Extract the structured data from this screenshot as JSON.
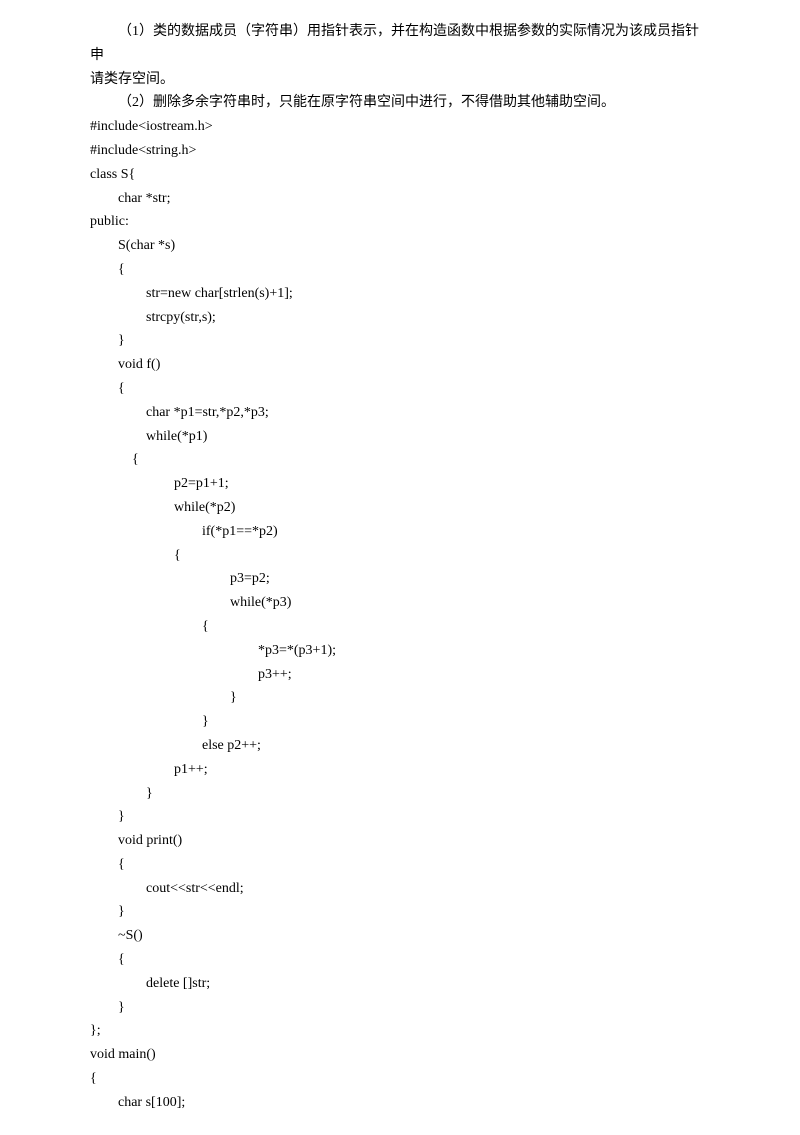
{
  "lines": [
    {
      "cls": "para indent",
      "text": "（1）类的数据成员（字符串）用指针表示，并在构造函数中根据参数的实际情况为该成员指针申"
    },
    {
      "cls": "para",
      "text": "请类存空间。"
    },
    {
      "cls": "para indent",
      "text": "（2）删除多余字符串时，只能在原字符串空间中进行，不得借助其他辅助空间。"
    },
    {
      "cls": "code-line",
      "text": "#include<iostream.h>"
    },
    {
      "cls": "code-line",
      "text": "#include<string.h>"
    },
    {
      "cls": "code-line",
      "text": "class S{"
    },
    {
      "cls": "code-line",
      "text": "        char *str;"
    },
    {
      "cls": "code-line",
      "text": "public:"
    },
    {
      "cls": "code-line",
      "text": "        S(char *s)"
    },
    {
      "cls": "code-line",
      "text": "        {"
    },
    {
      "cls": "code-line",
      "text": "                str=new char[strlen(s)+1];"
    },
    {
      "cls": "code-line",
      "text": "                strcpy(str,s);"
    },
    {
      "cls": "code-line",
      "text": "        }"
    },
    {
      "cls": "code-line",
      "text": "        void f()"
    },
    {
      "cls": "code-line",
      "text": "        {"
    },
    {
      "cls": "code-line",
      "text": "                char *p1=str,*p2,*p3;"
    },
    {
      "cls": "code-line",
      "text": "                while(*p1)"
    },
    {
      "cls": "code-line",
      "text": "            {"
    },
    {
      "cls": "code-line",
      "text": "                        p2=p1+1;"
    },
    {
      "cls": "code-line",
      "text": "                        while(*p2)"
    },
    {
      "cls": "code-line",
      "text": "                                if(*p1==*p2)"
    },
    {
      "cls": "code-line",
      "text": "                        {"
    },
    {
      "cls": "code-line",
      "text": "                                        p3=p2;"
    },
    {
      "cls": "code-line",
      "text": "                                        while(*p3)"
    },
    {
      "cls": "code-line",
      "text": "                                {"
    },
    {
      "cls": "code-line",
      "text": "                                                *p3=*(p3+1);"
    },
    {
      "cls": "code-line",
      "text": "                                                p3++;"
    },
    {
      "cls": "code-line",
      "text": "                                        }"
    },
    {
      "cls": "code-line",
      "text": "                                }"
    },
    {
      "cls": "code-line",
      "text": "                                else p2++;"
    },
    {
      "cls": "code-line",
      "text": "                        p1++;"
    },
    {
      "cls": "code-line",
      "text": "                }"
    },
    {
      "cls": "code-line",
      "text": "        }"
    },
    {
      "cls": "code-line",
      "text": "        void print()"
    },
    {
      "cls": "code-line",
      "text": "        {"
    },
    {
      "cls": "code-line",
      "text": "                cout<<str<<endl;"
    },
    {
      "cls": "code-line",
      "text": "        }"
    },
    {
      "cls": "code-line",
      "text": "        ~S()"
    },
    {
      "cls": "code-line",
      "text": "        {"
    },
    {
      "cls": "code-line",
      "text": "                delete []str;"
    },
    {
      "cls": "code-line",
      "text": "        }"
    },
    {
      "cls": "code-line",
      "text": "};"
    },
    {
      "cls": "code-line",
      "text": "void main()"
    },
    {
      "cls": "code-line",
      "text": "{"
    },
    {
      "cls": "code-line",
      "text": "        char s[100];"
    }
  ]
}
